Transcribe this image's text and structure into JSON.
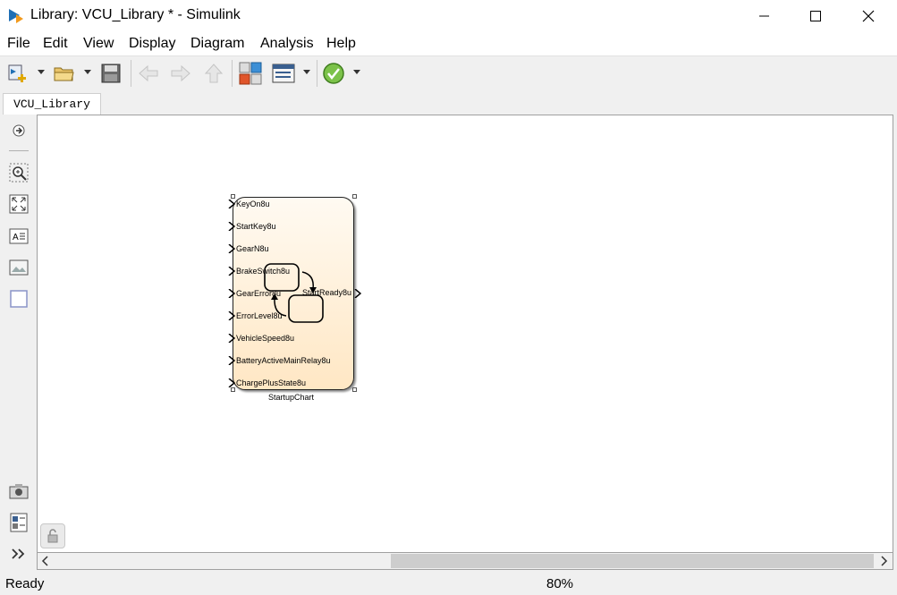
{
  "window": {
    "title": "Library: VCU_Library * - Simulink",
    "minimize_icon": "minimize-icon",
    "maximize_icon": "maximize-icon",
    "close_icon": "close-icon"
  },
  "menu": [
    "File",
    "Edit",
    "View",
    "Display",
    "Diagram",
    "Analysis",
    "Help"
  ],
  "toolbar": {
    "items": [
      "new-model-icon",
      "open-folder-icon",
      "save-icon",
      "back-arrow-icon",
      "forward-arrow-icon",
      "up-arrow-icon",
      "library-browser-icon",
      "model-explorer-icon",
      "check-icon"
    ]
  },
  "tab": {
    "label": "VCU_Library"
  },
  "palette": {
    "items": [
      "hide-show-browser-icon",
      "zoom-icon",
      "fit-to-view-icon",
      "annotation-icon",
      "image-icon",
      "area-icon",
      "screenshot-icon",
      "report-icon",
      "expand-icon"
    ]
  },
  "block": {
    "name": "StartupChart",
    "inputs": [
      "KeyOn8u",
      "StartKey8u",
      "GearN8u",
      "BrakeSwitch8u",
      "GearError8u",
      "ErrorLevel8u",
      "VehicleSpeed8u",
      "BatteryActiveMainRelay8u",
      "ChargePlusState8u"
    ],
    "output": "StartReady8u",
    "fill_top": "#fffaf2",
    "fill_bottom": "#ffe7c4"
  },
  "status": {
    "text": "Ready",
    "zoom": "80%"
  }
}
